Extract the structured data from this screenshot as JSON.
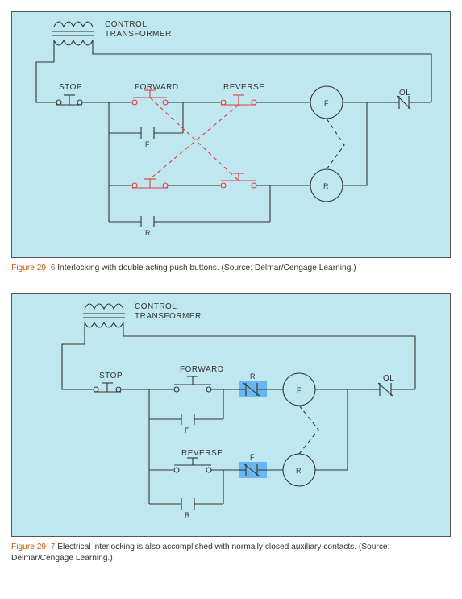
{
  "figure1": {
    "title": "Figure 29–6",
    "caption_main": "Interlocking with double acting push buttons. (Source: Delmar/Cengage Learning.)",
    "labels": {
      "control_transformer_1": "CONTROL",
      "control_transformer_2": "TRANSFORMER",
      "stop": "STOP",
      "forward": "FORWARD",
      "reverse": "REVERSE",
      "ol": "OL",
      "coil_f": "F",
      "coil_r": "R",
      "aux_f": "F",
      "aux_r": "R"
    }
  },
  "figure2": {
    "title": "Figure 29–7",
    "caption_main": "Electrical interlocking is also accomplished with normally closed auxiliary contacts. (Source: Delmar/Cengage Learning.)",
    "labels": {
      "control_transformer_1": "CONTROL",
      "control_transformer_2": "TRANSFORMER",
      "stop": "STOP",
      "forward": "FORWARD",
      "reverse": "REVERSE",
      "ol": "OL",
      "coil_f": "F",
      "coil_r": "R",
      "aux_f": "F",
      "aux_r": "R",
      "nc_r": "R",
      "nc_f": "F"
    }
  },
  "chart_data": [
    {
      "id": "29-6",
      "type": "ladder_control_diagram",
      "title": "Interlocking with double acting push buttons",
      "source": "Delmar/Cengage Learning",
      "power_source": "Control Transformer (step-down, two-winding)",
      "rungs": [
        {
          "name": "Forward rung",
          "series": [
            {
              "component": "pushbutton_NC",
              "label": "STOP",
              "color": "black"
            },
            {
              "component": "pushbutton_NO",
              "label": "FORWARD (NO contact of double-acting)",
              "color": "red"
            },
            {
              "component": "pushbutton_NC",
              "label": "REVERSE (NC contact of double-acting)",
              "color": "red"
            },
            {
              "component": "coil",
              "label": "F"
            },
            {
              "component": "overload_NC",
              "label": "OL"
            }
          ],
          "parallel_seal_in": {
            "around": "FORWARD NO",
            "component": "aux_NO",
            "label": "F"
          }
        },
        {
          "name": "Reverse rung",
          "series": [
            {
              "ref": "STOP (shared)"
            },
            {
              "component": "pushbutton_NC",
              "label": "FORWARD (NC contact of double-acting)",
              "color": "red"
            },
            {
              "component": "pushbutton_NO",
              "label": "REVERSE (NO contact of double-acting)",
              "color": "red"
            },
            {
              "component": "coil",
              "label": "R"
            },
            {
              "ref": "OL (shared)"
            }
          ],
          "parallel_seal_in": {
            "around": "all pushbuttons",
            "component": "aux_NO",
            "label": "R"
          }
        }
      ],
      "mechanical_interlock": {
        "between": [
          "F",
          "R"
        ],
        "shown_as": "dashed link"
      },
      "double_acting_links": [
        {
          "from": "FORWARD NO (forward rung)",
          "to": "FORWARD NC (reverse rung)",
          "shown_as": "red dashed"
        },
        {
          "from": "REVERSE NO (reverse rung)",
          "to": "REVERSE NC (forward rung)",
          "shown_as": "red dashed"
        }
      ]
    },
    {
      "id": "29-7",
      "type": "ladder_control_diagram",
      "title": "Electrical interlocking with normally closed auxiliary contacts",
      "source": "Delmar/Cengage Learning",
      "power_source": "Control Transformer (step-down, two-winding)",
      "rungs": [
        {
          "name": "Forward rung",
          "series": [
            {
              "component": "pushbutton_NC",
              "label": "STOP"
            },
            {
              "component": "pushbutton_NO",
              "label": "FORWARD"
            },
            {
              "component": "aux_NC",
              "label": "R",
              "highlight": "blue"
            },
            {
              "component": "coil",
              "label": "F"
            },
            {
              "component": "overload_NC",
              "label": "OL"
            }
          ],
          "parallel_seal_in": {
            "around": "FORWARD NO",
            "component": "aux_NO",
            "label": "F"
          }
        },
        {
          "name": "Reverse rung",
          "series": [
            {
              "ref": "STOP (shared)"
            },
            {
              "component": "pushbutton_NO",
              "label": "REVERSE"
            },
            {
              "component": "aux_NC",
              "label": "F",
              "highlight": "blue"
            },
            {
              "component": "coil",
              "label": "R"
            },
            {
              "ref": "OL (shared)"
            }
          ],
          "parallel_seal_in": {
            "around": "REVERSE NO",
            "component": "aux_NO",
            "label": "R"
          }
        }
      ],
      "mechanical_interlock": {
        "between": [
          "F",
          "R"
        ],
        "shown_as": "dashed link"
      }
    }
  ]
}
